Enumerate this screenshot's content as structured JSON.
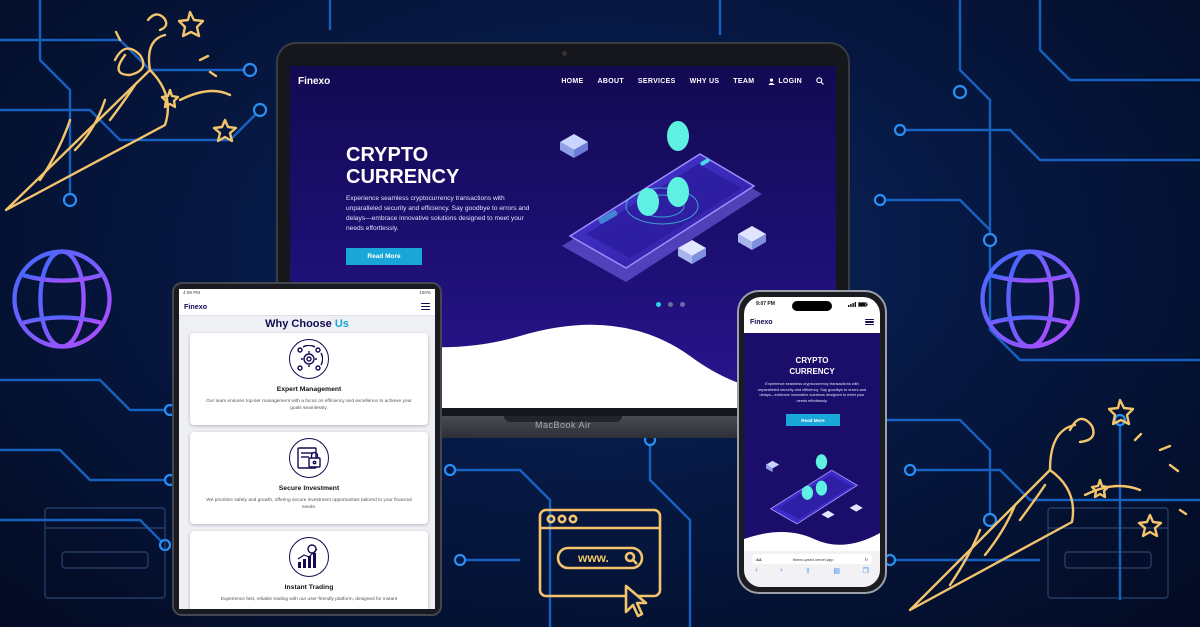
{
  "laptop": {
    "device_label": "MacBook Air",
    "site": {
      "logo": "Finexo",
      "nav": {
        "home": "HOME",
        "about": "ABOUT",
        "services": "SERVICES",
        "why_us": "WHY US",
        "team": "TEAM",
        "login": "LOGIN"
      },
      "hero": {
        "title_line1": "CRYPTO",
        "title_line2": "CURRENCY",
        "description": "Experience seamless cryptocurrency transactions with unparalleled security and efficiency. Say goodbye to errors and delays—embrace innovative solutions designed to meet your needs effortlessly.",
        "button": "Read More"
      }
    }
  },
  "tablet": {
    "status_time": "4:09 PM",
    "status_battery": "100%",
    "logo": "Finexo",
    "section_title": "Why Choose",
    "section_title_accent": "Us",
    "cards": [
      {
        "title": "Expert Management",
        "description": "Our team ensures top-tier management with a focus on efficiency and excellence to achieve your goals seamlessly.",
        "icon": "gear-people-icon"
      },
      {
        "title": "Secure Investment",
        "description": "We prioritize safety and growth, offering secure investment opportunities tailored to your financial needs.",
        "icon": "secure-invoice-icon"
      },
      {
        "title": "Instant Trading",
        "description": "Experience fast, reliable trading with our user-friendly platform, designed for instant",
        "icon": "bar-chart-coin-icon"
      }
    ]
  },
  "phone": {
    "status_time": "9:07 PM",
    "logo": "Finexo",
    "hero": {
      "title_line1": "CRYPTO",
      "title_line2": "CURRENCY",
      "description": "Experience seamless cryptocurrency transactions with unparalleled security and efficiency. Say goodbye to errors and delays—embrace innovative solutions designed to meet your needs effortlessly.",
      "button": "Read More"
    },
    "browser": {
      "aa": "AA",
      "url": "finexo-pearl.vercel.app"
    }
  },
  "decor": {
    "www_label": "www."
  },
  "colors": {
    "accent": "#19a6d8",
    "hero_bg": "#1d0f73",
    "brand_dark": "#130a52",
    "circuit": "#1a8ff0",
    "gold": "#f3c46b"
  }
}
